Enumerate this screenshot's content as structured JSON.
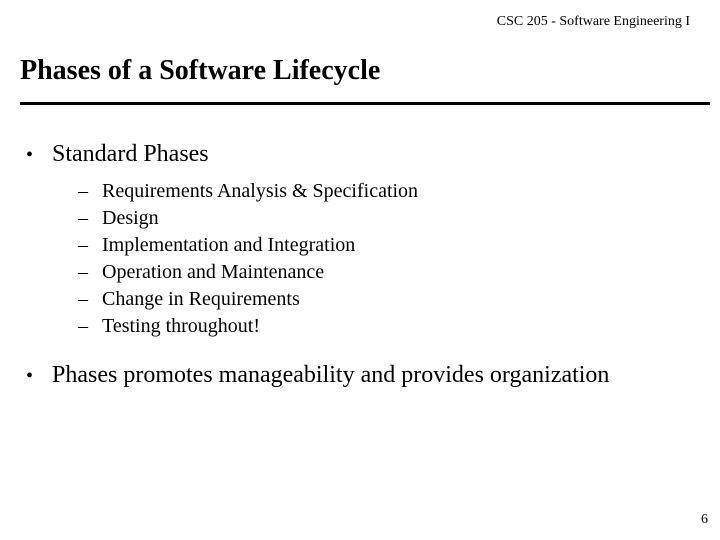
{
  "course_header": "CSC 205 - Software Engineering I",
  "title": "Phases of a Software Lifecycle",
  "bullets": {
    "top": "Standard Phases",
    "sub": [
      "Requirements Analysis & Specification",
      "Design",
      "Implementation and Integration",
      "Operation and Maintenance",
      "Change in Requirements",
      "Testing throughout!"
    ],
    "bottom": "Phases promotes manageability and provides organization"
  },
  "page_number": "6"
}
